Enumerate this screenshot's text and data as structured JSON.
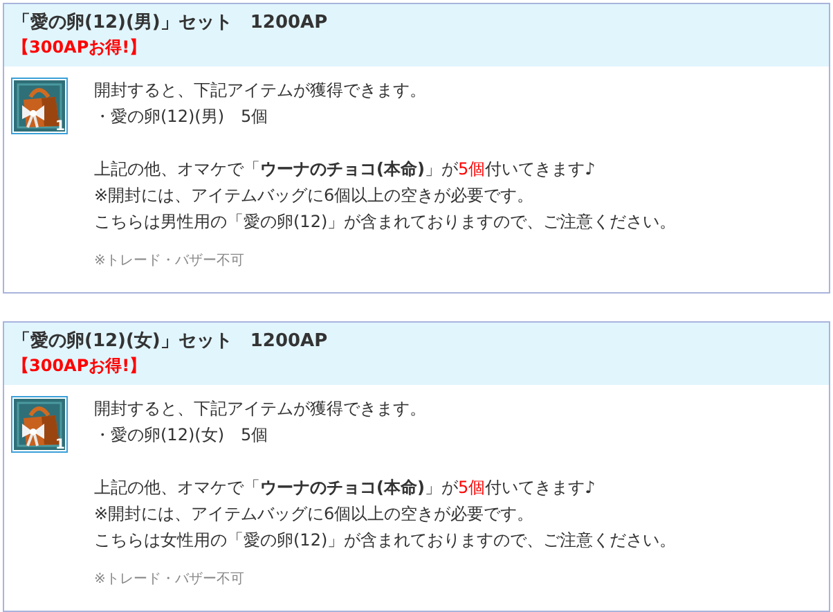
{
  "sets": [
    {
      "title": "「愛の卵(12)(男)」セット　1200AP",
      "deal": "【300APお得!】",
      "item_count": "1",
      "intro": "開封すると、下記アイテムが獲得できます。",
      "contents": "・愛の卵(12)(男)　5個",
      "bonus": [
        {
          "text": "上記の他、オマケで「",
          "kind": "plain"
        },
        {
          "text": "ウーナのチョコ(本命)",
          "kind": "bold"
        },
        {
          "text": "」が",
          "kind": "plain"
        },
        {
          "text": "5個",
          "kind": "red"
        },
        {
          "text": "付いてきます♪",
          "kind": "plain"
        }
      ],
      "requirement": "※開封には、アイテムバッグに6個以上の空きが必要です。",
      "caution": "こちらは男性用の「愛の卵(12)」が含まれておりますので、ご注意ください。",
      "restriction": "※トレード・バザー不可"
    },
    {
      "title": "「愛の卵(12)(女)」セット　1200AP",
      "deal": "【300APお得!】",
      "item_count": "1",
      "intro": "開封すると、下記アイテムが獲得できます。",
      "contents": "・愛の卵(12)(女)　5個",
      "bonus": [
        {
          "text": "上記の他、オマケで「",
          "kind": "plain"
        },
        {
          "text": "ウーナのチョコ(本命)",
          "kind": "bold"
        },
        {
          "text": "」が",
          "kind": "plain"
        },
        {
          "text": "5個",
          "kind": "red"
        },
        {
          "text": "付いてきます♪",
          "kind": "plain"
        }
      ],
      "requirement": "※開封には、アイテムバッグに6個以上の空きが必要です。",
      "caution": "こちらは女性用の「愛の卵(12)」が含まれておりますので、ご注意ください。",
      "restriction": "※トレード・バザー不可"
    }
  ]
}
